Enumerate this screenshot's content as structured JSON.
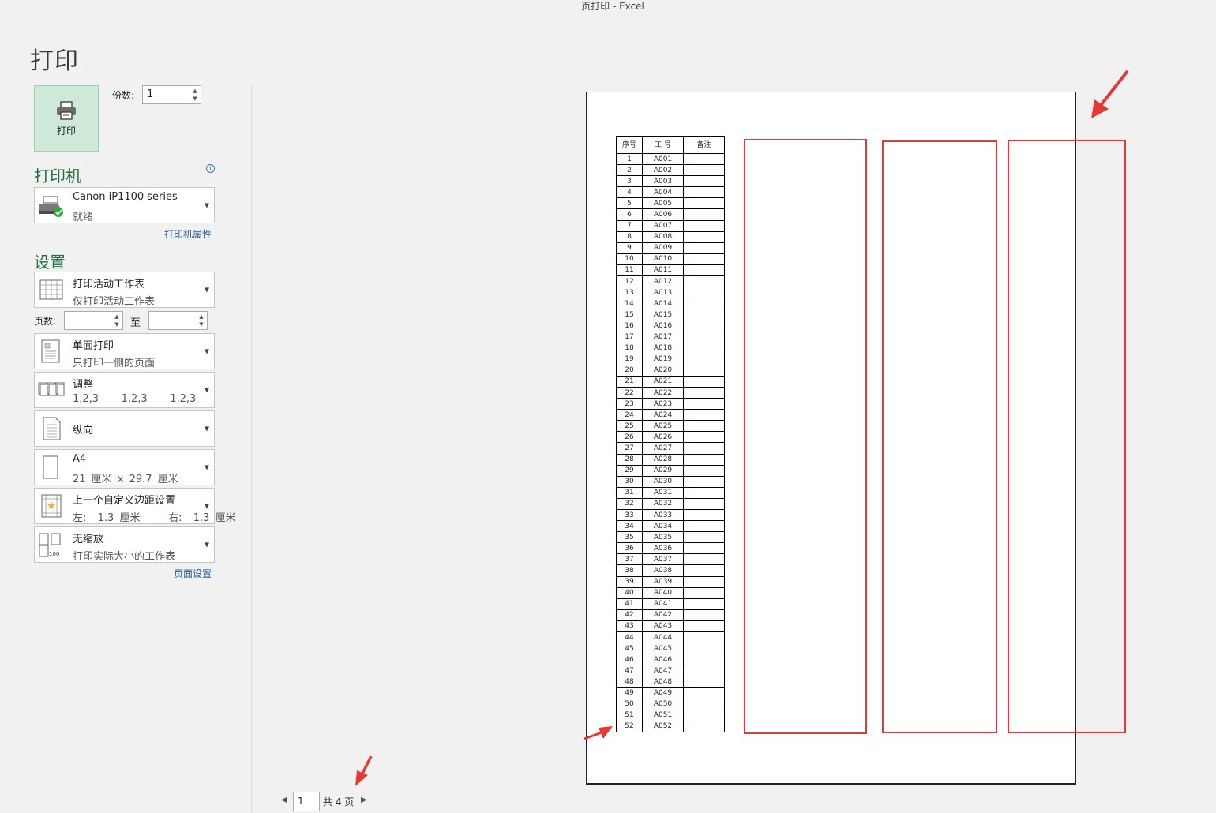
{
  "window_title": "一页打印 - Excel",
  "page_title": "打印",
  "print_button": {
    "label": "打印",
    "icon": "printer-icon"
  },
  "copies": {
    "label": "份数:",
    "value": "1"
  },
  "printer": {
    "heading": "打印机",
    "name": "Canon iP1100 series",
    "status": "就绪",
    "properties_link": "打印机属性"
  },
  "settings": {
    "heading": "设置",
    "what": {
      "title": "打印活动工作表",
      "sub": "仅打印活动工作表"
    },
    "pages_label": "页数:",
    "to_label": "至",
    "pages_from": "",
    "pages_to": "",
    "sides": {
      "title": "单面打印",
      "sub": "只打印一侧的页面"
    },
    "collate": {
      "title": "调整",
      "sub": "1,2,3    1,2,3    1,2,3"
    },
    "orientation": {
      "title": "纵向"
    },
    "paper": {
      "title": "A4",
      "sub": "21 厘米 x 29.7 厘米"
    },
    "margins": {
      "title": "上一个自定义边距设置",
      "sub": "左:  1.3 厘米     右:  1.3 厘米"
    },
    "scaling": {
      "title": "无缩放",
      "sub": "打印实际大小的工作表"
    },
    "page_setup_link": "页面设置"
  },
  "preview_nav": {
    "current_page": "1",
    "total": "共 4 页"
  },
  "sheet": {
    "headers": [
      "序号",
      "工 号",
      "备注"
    ],
    "rows": [
      [
        "1",
        "A001"
      ],
      [
        "2",
        "A002"
      ],
      [
        "3",
        "A003"
      ],
      [
        "4",
        "A004"
      ],
      [
        "5",
        "A005"
      ],
      [
        "6",
        "A006"
      ],
      [
        "7",
        "A007"
      ],
      [
        "8",
        "A008"
      ],
      [
        "9",
        "A009"
      ],
      [
        "10",
        "A010"
      ],
      [
        "11",
        "A011"
      ],
      [
        "12",
        "A012"
      ],
      [
        "13",
        "A013"
      ],
      [
        "14",
        "A014"
      ],
      [
        "15",
        "A015"
      ],
      [
        "16",
        "A016"
      ],
      [
        "17",
        "A017"
      ],
      [
        "18",
        "A018"
      ],
      [
        "19",
        "A019"
      ],
      [
        "20",
        "A020"
      ],
      [
        "21",
        "A021"
      ],
      [
        "22",
        "A022"
      ],
      [
        "23",
        "A023"
      ],
      [
        "24",
        "A024"
      ],
      [
        "25",
        "A025"
      ],
      [
        "26",
        "A026"
      ],
      [
        "27",
        "A027"
      ],
      [
        "28",
        "A028"
      ],
      [
        "29",
        "A029"
      ],
      [
        "30",
        "A030"
      ],
      [
        "31",
        "A031"
      ],
      [
        "32",
        "A032"
      ],
      [
        "33",
        "A033"
      ],
      [
        "34",
        "A034"
      ],
      [
        "35",
        "A035"
      ],
      [
        "36",
        "A036"
      ],
      [
        "37",
        "A037"
      ],
      [
        "38",
        "A038"
      ],
      [
        "39",
        "A039"
      ],
      [
        "40",
        "A040"
      ],
      [
        "41",
        "A041"
      ],
      [
        "42",
        "A042"
      ],
      [
        "43",
        "A043"
      ],
      [
        "44",
        "A044"
      ],
      [
        "45",
        "A045"
      ],
      [
        "46",
        "A046"
      ],
      [
        "47",
        "A047"
      ],
      [
        "48",
        "A048"
      ],
      [
        "49",
        "A049"
      ],
      [
        "50",
        "A050"
      ],
      [
        "51",
        "A051"
      ],
      [
        "52",
        "A052"
      ]
    ]
  },
  "colors": {
    "accent": "#217346",
    "print_button_bg": "#cfe9d9",
    "annotation": "#e53935",
    "link": "#2a5d9e"
  }
}
